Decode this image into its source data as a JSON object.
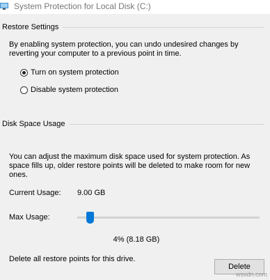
{
  "window": {
    "title": "System Protection for Local Disk (C:)"
  },
  "restore_settings": {
    "heading": "Restore Settings",
    "description": "By enabling system protection, you can undo undesired changes by reverting your computer to a previous point in time.",
    "options": [
      {
        "label": "Turn on system protection",
        "selected": true
      },
      {
        "label": "Disable system protection",
        "selected": false
      }
    ]
  },
  "disk_space": {
    "heading": "Disk Space Usage",
    "description": "You can adjust the maximum disk space used for system protection. As space fills up, older restore points will be deleted to make room for new ones.",
    "current_usage_label": "Current Usage:",
    "current_usage_value": "9.00 GB",
    "max_usage_label": "Max Usage:",
    "max_usage_fraction": 0.04,
    "max_usage_value": "4% (8.18 GB)",
    "delete_text": "Delete all restore points for this drive.",
    "delete_button": "Delete"
  },
  "watermark": "wsxdn.com"
}
